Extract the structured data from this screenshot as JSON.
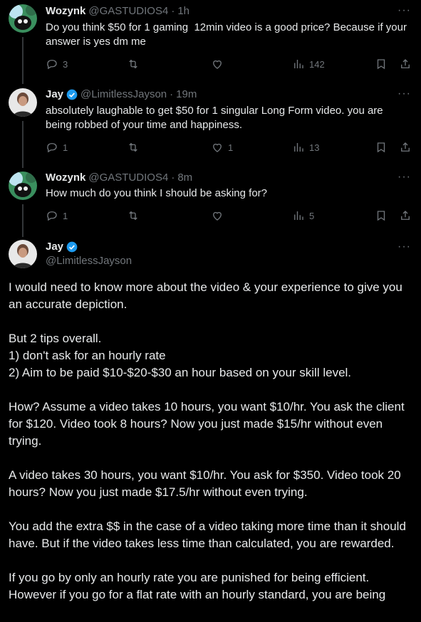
{
  "tweets": [
    {
      "name": "Wozynk",
      "handle": "@GASTUDIOS4",
      "dot": "·",
      "time": "1h",
      "text": "Do you think $50 for 1 gaming  12min video is a good price? Because if your answer is yes dm me",
      "replies": "3",
      "likes": "",
      "views": "142"
    },
    {
      "name": "Jay",
      "handle": "@LimitlessJayson",
      "dot": "·",
      "time": "19m",
      "text": "absolutely laughable to get $50 for 1 singular Long Form video. you are being robbed of your time and happiness.",
      "replies": "1",
      "likes": "1",
      "views": "13"
    },
    {
      "name": "Wozynk",
      "handle": "@GASTUDIOS4",
      "dot": "·",
      "time": "8m",
      "text": "How much do you think I should be asking for?",
      "replies": "1",
      "likes": "",
      "views": "5"
    }
  ],
  "main": {
    "name": "Jay",
    "handle": "@LimitlessJayson",
    "text": "I would need to know more about the video & your experience to give you an accurate depiction.\n\nBut 2 tips overall.\n1) don't ask for an hourly rate\n2) Aim to be paid $10-$20-$30 an hour based on your skill level.\n\nHow? Assume a video takes 10 hours, you want $10/hr. You ask the client for $120. Video took 8 hours? Now you just made $15/hr without even trying.\n\nA video takes 30 hours, you want $10/hr. You ask for $350. Video took 20 hours? Now you just made $17.5/hr without even trying.\n\nYou add the extra $$ in the case of a video taking more time than it should have. But if the video takes less time than calculated, you are rewarded.\n\nIf you go by only an hourly rate you are punished for being efficient. However if you go for a flat rate with an hourly standard, you are being"
  },
  "more_label": "···",
  "colors": {
    "verified": "#1d9bf0",
    "muted": "#71767b",
    "text": "#e7e9ea"
  }
}
